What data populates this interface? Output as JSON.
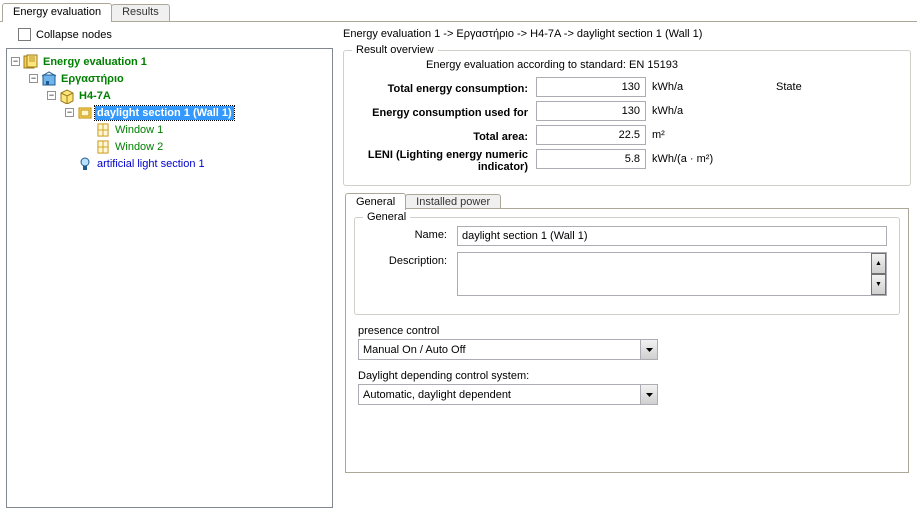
{
  "tabs": {
    "energy_eval": "Energy evaluation",
    "results": "Results"
  },
  "collapse_label": "Collapse nodes",
  "tree": {
    "root": "Energy evaluation 1",
    "n1": "Εργαστήριο",
    "n2": "H4-7A",
    "n3": "daylight section 1 (Wall 1)",
    "w1": "Window 1",
    "w2": "Window 2",
    "art": "artificial light section 1"
  },
  "breadcrumb": "Energy evaluation 1 -> Εργαστήριο -> H4-7A -> daylight section 1 (Wall 1)",
  "overview": {
    "legend": "Result overview",
    "standard_line": "Energy evaluation according to standard: EN 15193",
    "state_label": "State",
    "rows": {
      "total_energy_lbl": "Total energy consumption:",
      "total_energy_val": "130",
      "total_energy_unit": "kWh/a",
      "used_for_lbl": "Energy consumption used for",
      "used_for_val": "130",
      "used_for_unit": "kWh/a",
      "area_lbl": "Total area:",
      "area_val": "22.5",
      "area_unit": "m²",
      "leni_lbl": "LENI (Lighting energy numeric indicator)",
      "leni_val": "5.8",
      "leni_unit": "kWh/(a · m²)"
    }
  },
  "subtabs": {
    "general": "General",
    "installed": "Installed power"
  },
  "general_form": {
    "legend": "General",
    "name_lbl": "Name:",
    "name_val": "daylight section 1 (Wall 1)",
    "desc_lbl": "Description:",
    "desc_val": ""
  },
  "presence": {
    "label": "presence control",
    "value": "Manual On / Auto Off"
  },
  "daylight": {
    "label": "Daylight depending control system:",
    "value": "Automatic, daylight dependent"
  }
}
